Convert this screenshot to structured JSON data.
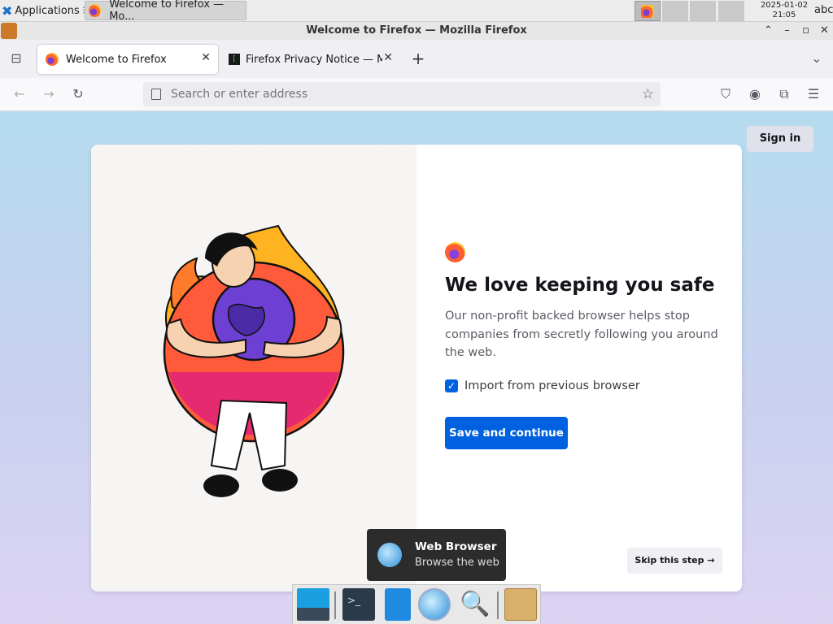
{
  "panel": {
    "applications_label": "Applications",
    "task_title": "Welcome to Firefox — Mo...",
    "clock_date": "2025-01-02",
    "clock_time": "21:05",
    "keyboard_layout": "abc"
  },
  "window": {
    "title": "Welcome to Firefox — Mozilla Firefox"
  },
  "tabs": [
    {
      "label": "Welcome to Firefox",
      "active": true
    },
    {
      "label": "Firefox Privacy Notice — M",
      "active": false
    }
  ],
  "navbar": {
    "url_placeholder": "Search or enter address"
  },
  "page": {
    "signin_label": "Sign in",
    "heading": "We love keeping you safe",
    "subtext": "Our non-profit backed browser helps stop companies from secretly following you around the web.",
    "import_checkbox_label": "Import from previous browser",
    "import_checked": true,
    "save_button": "Save and continue",
    "skip_button": "Skip this step →"
  },
  "tooltip": {
    "title": "Web Browser",
    "subtitle": "Browse the web"
  },
  "colors": {
    "accent": "#0061e0",
    "gradient_top": "#b5dbee",
    "gradient_bottom": "#dcd3f3"
  }
}
